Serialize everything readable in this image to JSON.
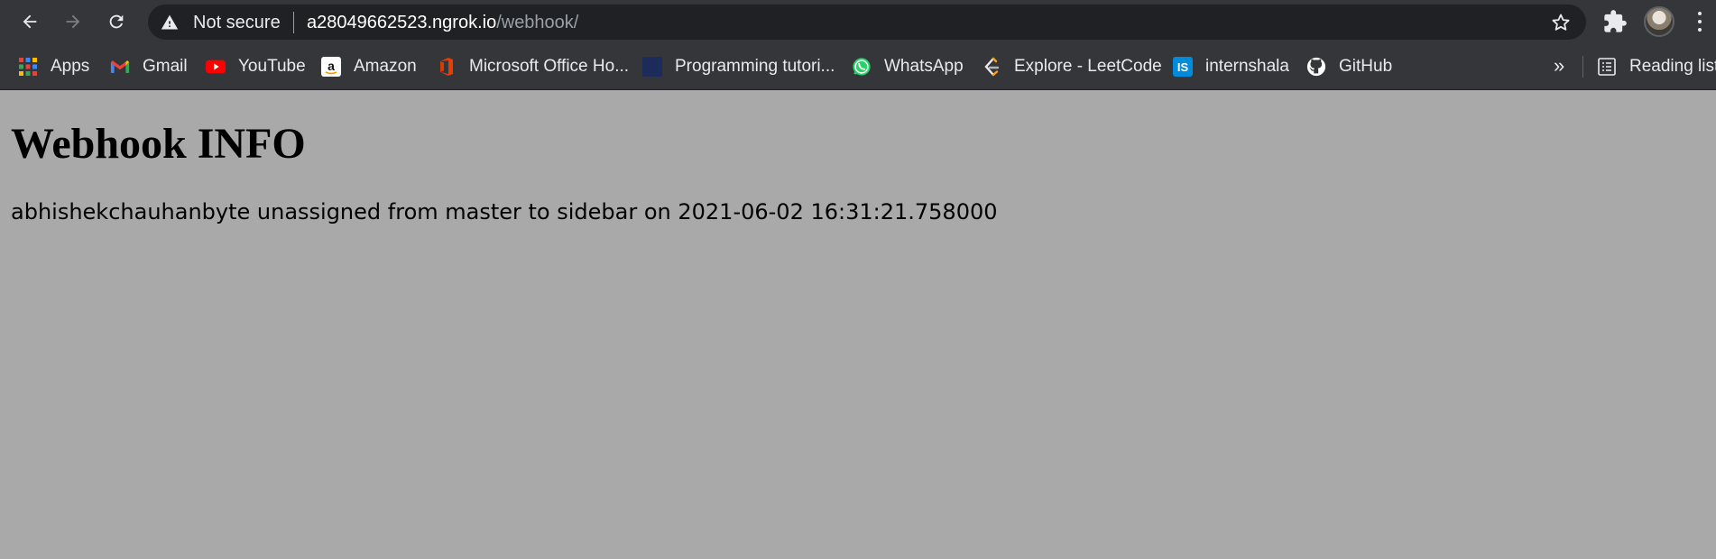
{
  "browser": {
    "security_label": "Not secure",
    "url_host": "a28049662523.ngrok.io",
    "url_path": "/webhook/",
    "bookmarks": [
      {
        "label": "Apps",
        "icon": "apps-grid-icon"
      },
      {
        "label": "Gmail",
        "icon": "gmail-icon"
      },
      {
        "label": "YouTube",
        "icon": "youtube-icon"
      },
      {
        "label": "Amazon",
        "icon": "amazon-icon"
      },
      {
        "label": "Microsoft Office Ho...",
        "icon": "office-icon"
      },
      {
        "label": "Programming tutori...",
        "icon": "programming-icon"
      },
      {
        "label": "WhatsApp",
        "icon": "whatsapp-icon"
      },
      {
        "label": "Explore - LeetCode",
        "icon": "leetcode-icon"
      },
      {
        "label": "internshala",
        "icon": "internshala-icon"
      },
      {
        "label": "GitHub",
        "icon": "github-icon"
      }
    ],
    "more_label": "»",
    "reading_list_label": "Reading list"
  },
  "page": {
    "title": "Webhook INFO",
    "message": "abhishekchauhanbyte unassigned from master to sidebar on 2021-06-02 16:31:21.758000"
  },
  "colors": {
    "page_background": "#a9a9a9",
    "chrome_background": "#35363a",
    "omnibox_background": "#202124"
  }
}
